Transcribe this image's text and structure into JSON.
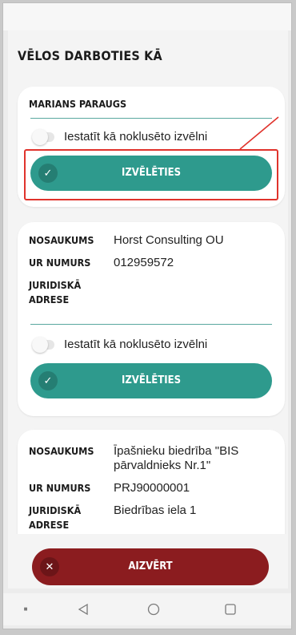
{
  "page": {
    "title": "VĒLOS DARBOTIES KĀ"
  },
  "cards": [
    {
      "name": "MARIANS PARAUGS",
      "toggle_label": "Iestatīt kā noklusēto izvēlni",
      "toggle_on": false,
      "select_label": "IZVĒLĒTIES",
      "select_icon": "check-icon"
    },
    {
      "fields": [
        {
          "label": "NOSAUKUMS",
          "value": "Horst Consulting OU"
        },
        {
          "label": "UR NUMURS",
          "value": "012959572"
        },
        {
          "label": "JURIDISKĀ ADRESE",
          "value": ""
        }
      ],
      "toggle_label": "Iestatīt kā noklusēto izvēlni",
      "toggle_on": false,
      "select_label": "IZVĒLĒTIES",
      "select_icon": "check-icon"
    },
    {
      "fields": [
        {
          "label": "NOSAUKUMS",
          "value": "Īpašnieku biedrība \"BIS pārvaldnieks Nr.1\""
        },
        {
          "label": "UR NUMURS",
          "value": "PRJ90000001"
        },
        {
          "label": "JURIDISKĀ ADRESE",
          "value": "Biedrības iela 1"
        }
      ]
    }
  ],
  "footer": {
    "close_label": "AIZVĒRT",
    "close_icon": "close-icon"
  },
  "navbar": {
    "items": [
      "menu-dot-icon",
      "back-icon",
      "home-icon",
      "recents-icon"
    ]
  },
  "colors": {
    "accent": "#2e9a8d",
    "close": "#8b1c1f",
    "highlight": "#e0332c"
  }
}
